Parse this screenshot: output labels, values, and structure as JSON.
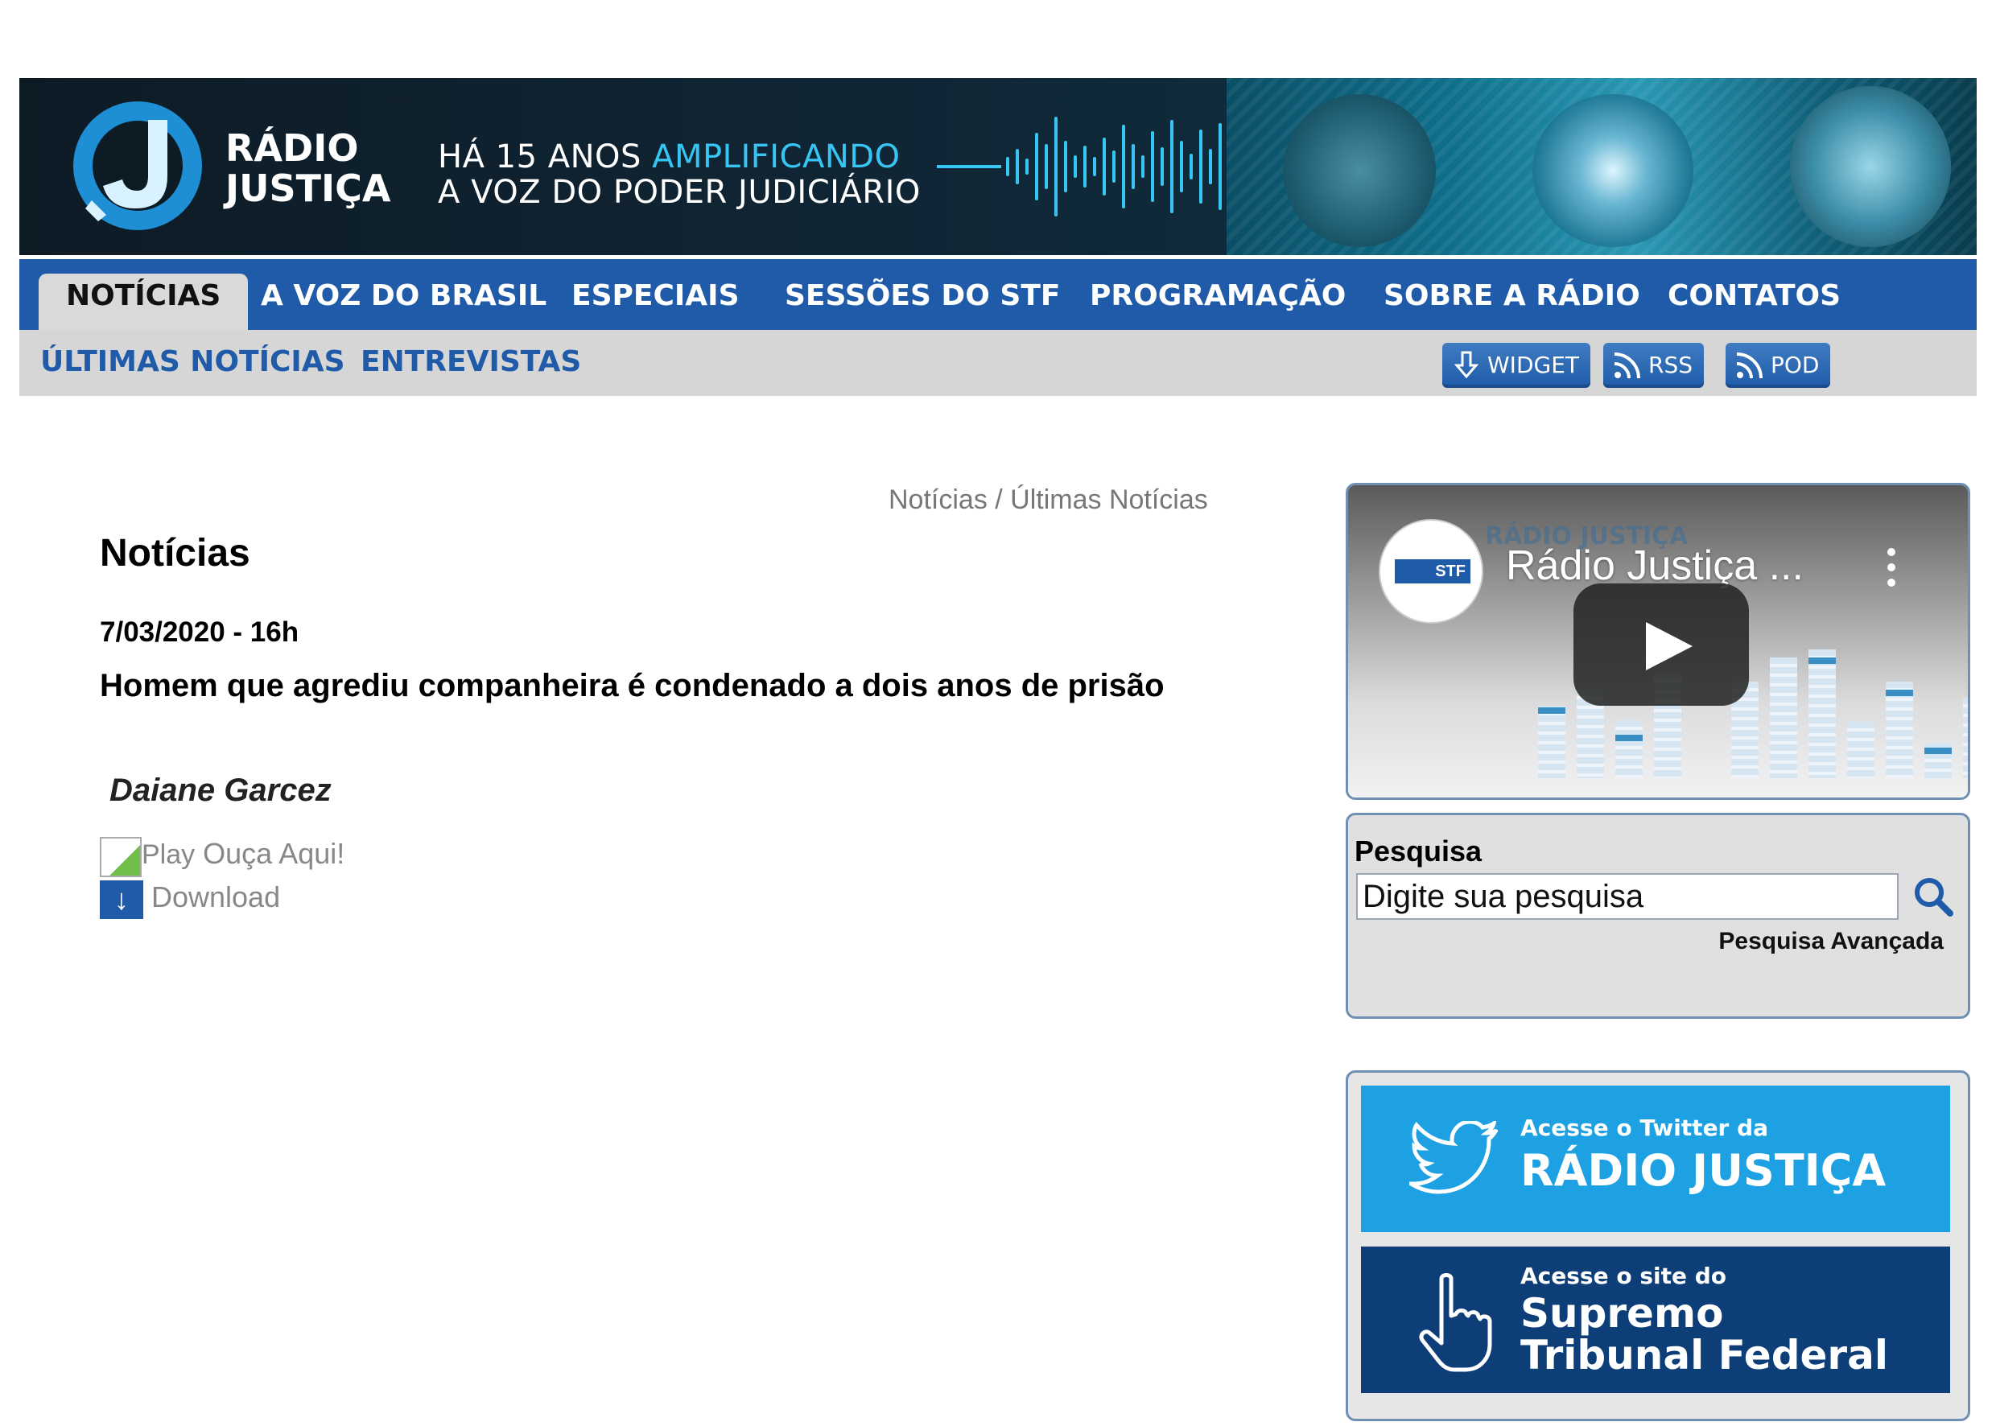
{
  "header": {
    "brand_line1": "RÁDIO",
    "brand_line2": "JUSTIÇA",
    "slogan_prefix": "HÁ 15 ANOS ",
    "slogan_accent": "AMPLIFICANDO",
    "slogan_line2": "A VOZ DO PODER JUDICIÁRIO",
    "accent_color": "#37c6f4"
  },
  "nav": {
    "items": [
      {
        "label": "NOTÍCIAS",
        "active": true
      },
      {
        "label": "A VOZ DO BRASIL"
      },
      {
        "label": "ESPECIAIS"
      },
      {
        "label": "SESSÕES DO STF"
      },
      {
        "label": "PROGRAMAÇÃO"
      },
      {
        "label": "SOBRE A RÁDIO"
      },
      {
        "label": "CONTATOS"
      }
    ],
    "color": "#1f5ba8"
  },
  "subnav": {
    "items": [
      {
        "label": "ÚLTIMAS NOTÍCIAS"
      },
      {
        "label": "ENTREVISTAS"
      }
    ],
    "buttons": [
      {
        "label": "WIDGET",
        "icon": "download-arrow-icon"
      },
      {
        "label": "RSS",
        "icon": "rss-icon"
      },
      {
        "label": "POD",
        "icon": "rss-icon"
      }
    ]
  },
  "main": {
    "breadcrumb": "Notícias / Últimas Notícias",
    "title": "Notícias",
    "date": "7/03/2020 - 16h",
    "headline": "Homem que agrediu companheira é condenado a dois anos de prisão",
    "author": "Daiane Garcez",
    "play_alt": "Play",
    "play_label": "Ouça Aqui!",
    "download_label": "Download"
  },
  "sidebar": {
    "video": {
      "title": "Rádio Justiça ...",
      "channel_badge": "STF",
      "watermark": "RÁDIO JUSTIÇA"
    },
    "search": {
      "label": "Pesquisa",
      "placeholder": "Digite sua pesquisa",
      "advanced": "Pesquisa Avançada"
    },
    "twitter_banner": {
      "small": "Acesse o Twitter da",
      "big": "RÁDIO JUSTIÇA",
      "color": "#1da1e2"
    },
    "stf_banner": {
      "small": "Acesse o site do",
      "big1": "Supremo",
      "big2": "Tribunal Federal",
      "color": "#0d3e78"
    }
  }
}
